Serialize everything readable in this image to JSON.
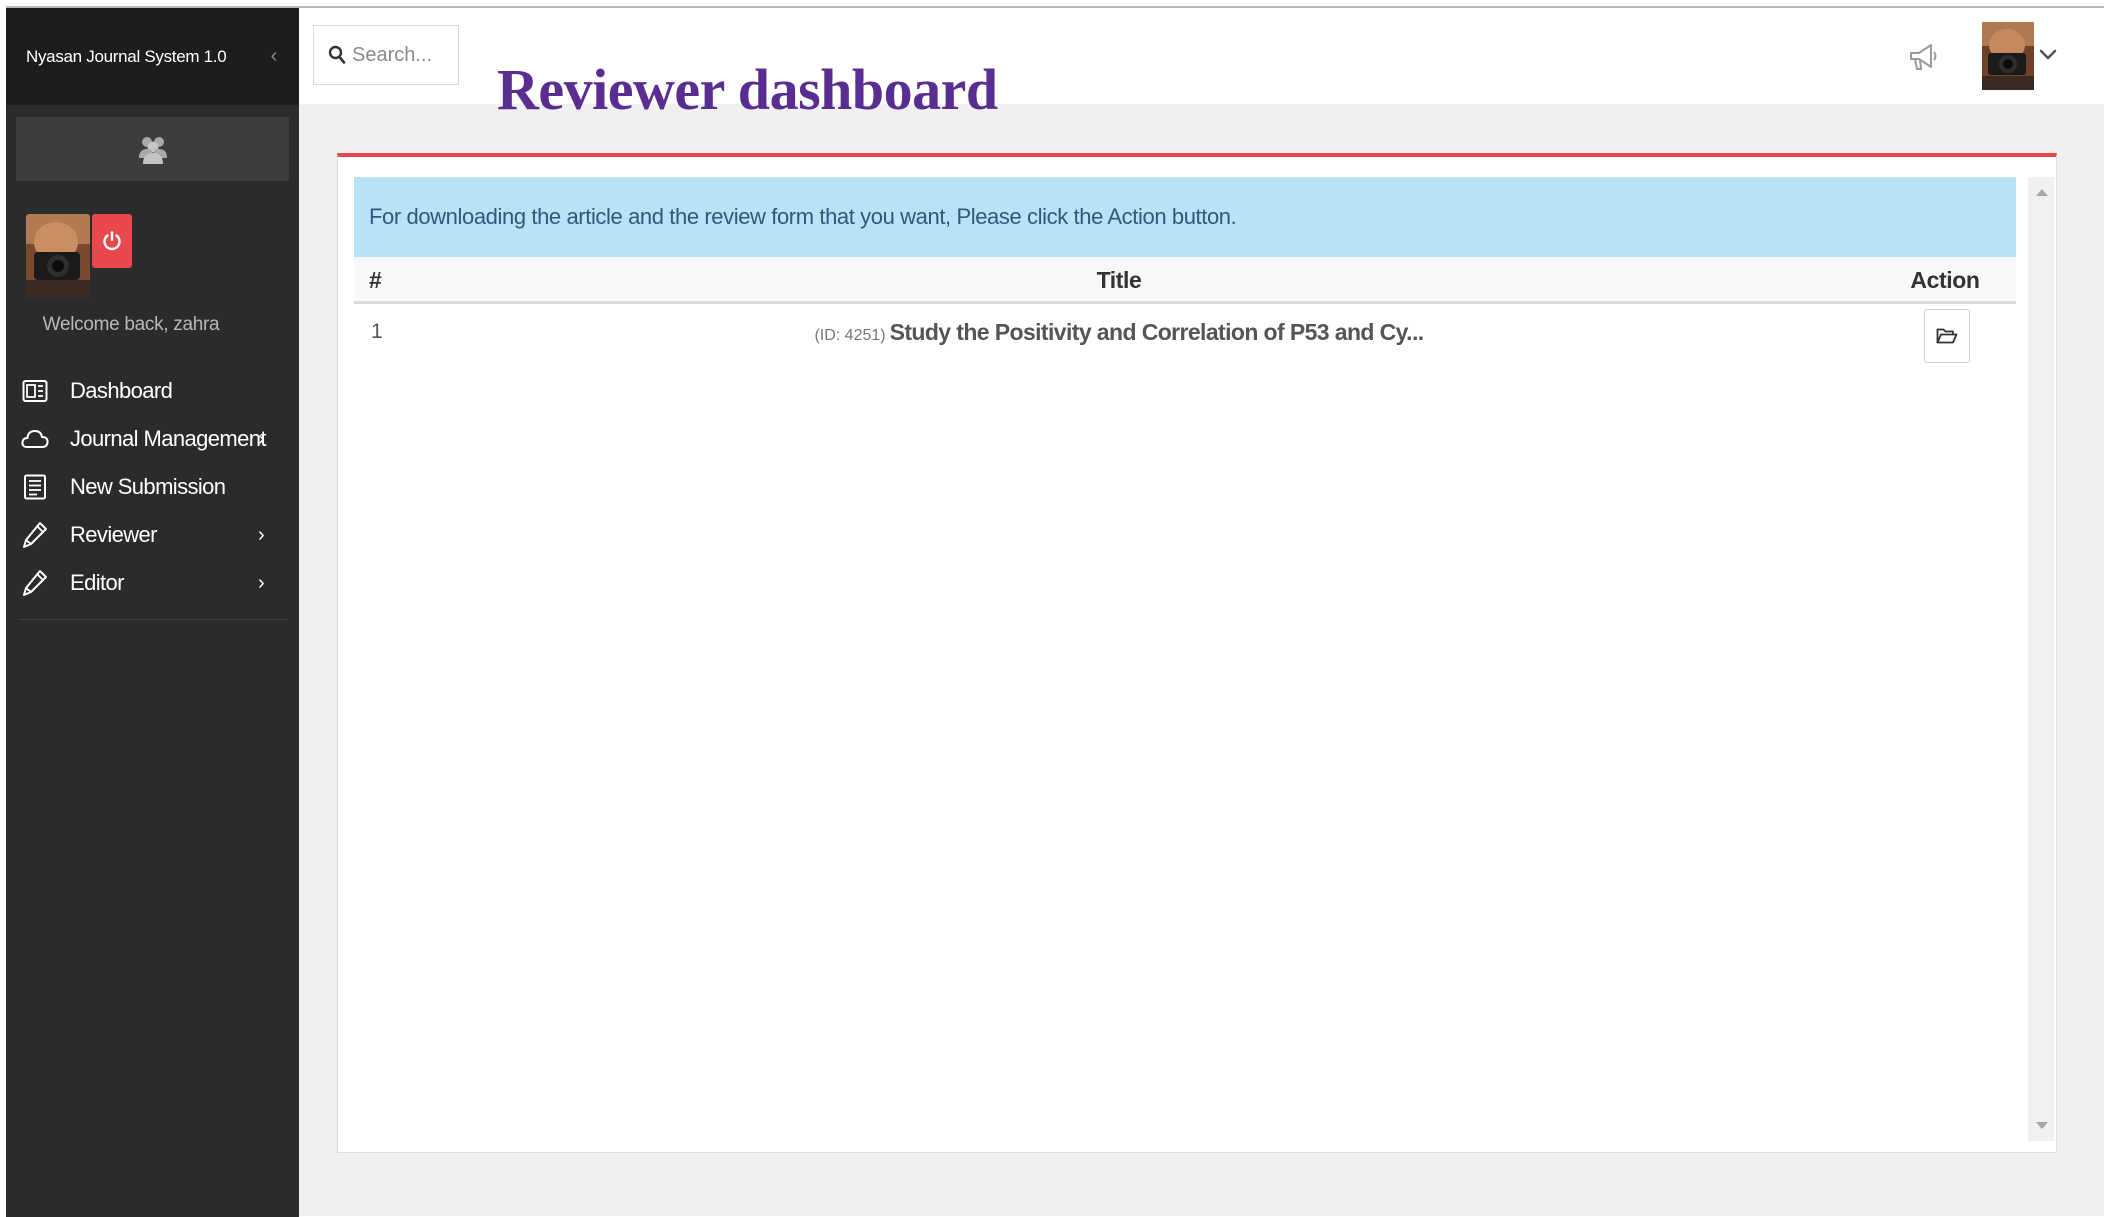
{
  "app": {
    "brand": "Nyasan Journal System 1.0"
  },
  "sidebar": {
    "welcome": "Welcome back, zahra",
    "items": [
      {
        "label": "Dashboard",
        "icon": "dashboard-icon",
        "has_children": false
      },
      {
        "label": "Journal Management",
        "icon": "cloud-icon",
        "has_children": true
      },
      {
        "label": "New Submission",
        "icon": "document-icon",
        "has_children": false
      },
      {
        "label": "Reviewer",
        "icon": "pencil-icon",
        "has_children": true
      },
      {
        "label": "Editor",
        "icon": "pencil-icon",
        "has_children": true
      }
    ]
  },
  "header": {
    "search_placeholder": "Search...",
    "page_title": "Reviewer dashboard"
  },
  "main": {
    "alert": "For downloading the article and the review form that you want, Please click the Action button.",
    "table": {
      "headers": {
        "num": "#",
        "title": "Title",
        "action": "Action"
      },
      "rows": [
        {
          "num": "1",
          "id_label": "(ID: 4251)",
          "title": "Study the Positivity and Correlation of P53 and Cy..."
        }
      ]
    }
  },
  "colors": {
    "sidebar_bg": "#2a2b2d",
    "accent_red": "#e8474b",
    "title_purple": "#5a2d91",
    "alert_bg": "#b8e2f8"
  }
}
